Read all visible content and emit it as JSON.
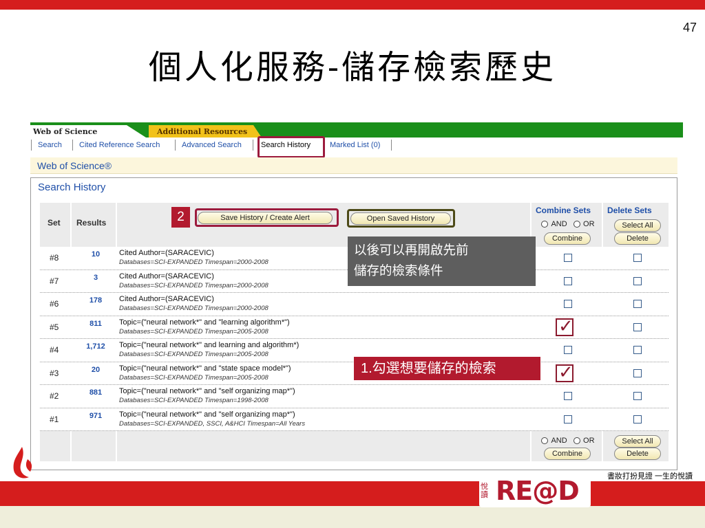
{
  "slide": {
    "page_number": "47",
    "title": "個人化服務-儲存檢索歷史",
    "slogan": "書妝打扮見證 一生的悅讀",
    "logo_text": "RE@D",
    "logo_side": "悅讀"
  },
  "tabs": {
    "wos": "Web of Science",
    "additional": "Additional Resources"
  },
  "subnav": {
    "search": "Search",
    "cited": "Cited Reference Search",
    "advanced": "Advanced Search",
    "history": "Search History",
    "marked": "Marked List (0)"
  },
  "banner": "Web of Science®",
  "panel_title": "Search History",
  "header": {
    "set": "Set",
    "results": "Results",
    "save_button": "Save History / Create Alert",
    "open_button": "Open Saved History",
    "combine_title": "Combine Sets",
    "and_label": "AND",
    "or_label": "OR",
    "combine_button": "Combine",
    "delete_title": "Delete Sets",
    "select_all_button": "Select All",
    "delete_button": "Delete"
  },
  "rows": [
    {
      "set": "#8",
      "results": "10",
      "query": "Cited Author=(SARACEVIC)",
      "db": "Databases=SCI-EXPANDED Timespan=2000-2008",
      "combine_checked": false
    },
    {
      "set": "#7",
      "results": "3",
      "query": "Cited Author=(SARACEVIC)",
      "db": "Databases=SCI-EXPANDED Timespan=2000-2008",
      "combine_checked": false
    },
    {
      "set": "#6",
      "results": "178",
      "query": "Cited Author=(SARACEVIC)",
      "db": "Databases=SCI-EXPANDED Timespan=2000-2008",
      "combine_checked": false
    },
    {
      "set": "#5",
      "results": "811",
      "query": "Topic=(\"neural network*\" and \"learning algorithm*\")",
      "db": "Databases=SCI-EXPANDED Timespan=2005-2008",
      "combine_checked": true
    },
    {
      "set": "#4",
      "results": "1,712",
      "query": "Topic=(\"neural network*\" and learning and algorithm*)",
      "db": "Databases=SCI-EXPANDED Timespan=2005-2008",
      "combine_checked": false
    },
    {
      "set": "#3",
      "results": "20",
      "query": "Topic=(\"neural network*\" and \"state space model*\")",
      "db": "Databases=SCI-EXPANDED Timespan=2005-2008",
      "combine_checked": true
    },
    {
      "set": "#2",
      "results": "881",
      "query": "Topic=(\"neural network*\" and \"self organizing map*\")",
      "db": "Databases=SCI-EXPANDED Timespan=1998-2008",
      "combine_checked": false
    },
    {
      "set": "#1",
      "results": "971",
      "query": "Topic=(\"neural network*\" and \"self organizing map*\")",
      "db": "Databases=SCI-EXPANDED, SSCI, A&HCI Timespan=All Years",
      "combine_checked": false
    }
  ],
  "annotations": {
    "badge": "2",
    "gray_line1": "以後可以再開啟先前",
    "gray_line2": "儲存的檢索條件",
    "red_callout": "1.勾選想要儲存的檢索"
  },
  "colors": {
    "accent_red": "#d51d1d",
    "wos_green": "#1a8f1a",
    "link_blue": "#1f4fa8",
    "highlight": "#9c1b3d"
  }
}
